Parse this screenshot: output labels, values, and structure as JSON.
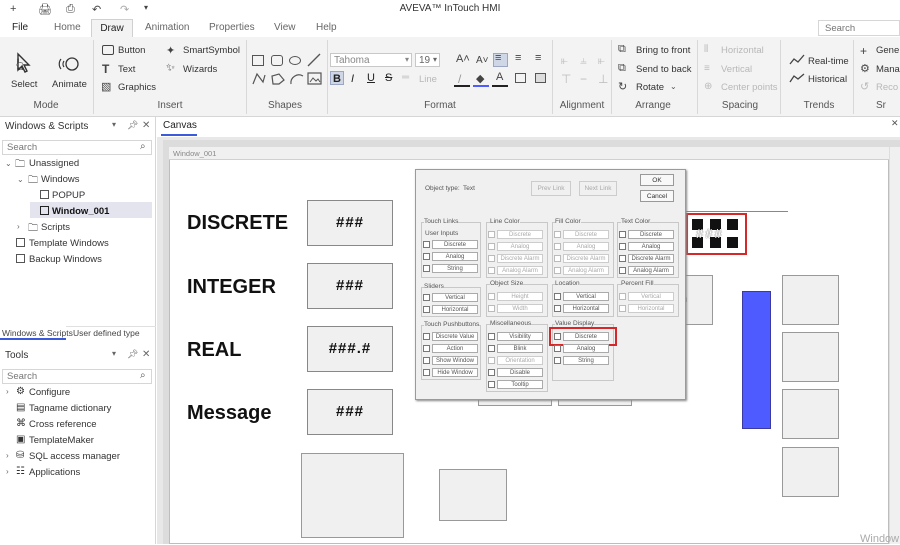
{
  "app": {
    "title": "AVEVA™ InTouch HMI"
  },
  "quick_access": {
    "new_icon": "+",
    "save_icon": "🖨",
    "print_icon": "⎙",
    "undo_icon": "↶",
    "redo_icon": "↷",
    "more_icon": "▾"
  },
  "menu": {
    "items": [
      "File",
      "Home",
      "Draw",
      "Animation",
      "Properties",
      "View",
      "Help"
    ],
    "active": "Draw"
  },
  "search": {
    "placeholder": "Search"
  },
  "ribbon": {
    "mode": {
      "select": "Select",
      "animate": "Animate",
      "group": "Mode"
    },
    "insert": {
      "button": "Button",
      "text": "Text",
      "graphics": "Graphics",
      "smartsymbol": "SmartSymbol",
      "wizards": "Wizards",
      "group": "Insert"
    },
    "shapes": {
      "group": "Shapes"
    },
    "format": {
      "font": "Tahoma",
      "size": "19",
      "line": "Line",
      "group": "Format"
    },
    "alignment": {
      "group": "Alignment"
    },
    "arrange": {
      "bring_front": "Bring to front",
      "send_back": "Send to back",
      "rotate": "Rotate",
      "group": "Arrange"
    },
    "spacing": {
      "horizontal": "Horizontal",
      "vertical": "Vertical",
      "center_points": "Center points",
      "group": "Spacing"
    },
    "trends": {
      "realtime": "Real-time",
      "historical": "Historical",
      "group": "Trends"
    },
    "smart": {
      "generate": "Gene",
      "manage": "Mana",
      "recover": "Reco",
      "group": "Sr"
    }
  },
  "windows_panel": {
    "title": "Windows & Scripts",
    "search_placeholder": "Search",
    "tree": {
      "unassigned": "Unassigned",
      "windows": "Windows",
      "popup": "POPUP",
      "window_001": "Window_001",
      "scripts": "Scripts",
      "template_windows": "Template Windows",
      "backup_windows": "Backup Windows"
    },
    "tabs": [
      "Windows & Scripts",
      "User defined type"
    ]
  },
  "tools_panel": {
    "title": "Tools",
    "search_placeholder": "Search",
    "items": [
      "Configure",
      "Tagname dictionary",
      "Cross reference",
      "TemplateMaker",
      "SQL access manager",
      "Applications"
    ]
  },
  "canvas": {
    "tab": "Canvas",
    "window_title": "Window_001",
    "labels": {
      "discrete": "DISCRETE",
      "integer": "INTEGER",
      "real": "REAL",
      "message": "Message"
    },
    "values": {
      "discrete": "###",
      "integer": "###",
      "real": "###.#",
      "message": "###"
    },
    "partial_text": "n",
    "corner_text": "Window"
  },
  "dialog": {
    "object_type_label": "Object type:",
    "object_type_value": "Text",
    "prev_link": "Prev Link",
    "next_link": "Next Link",
    "ok": "OK",
    "cancel": "Cancel",
    "touch_links": {
      "title": "Touch Links",
      "user_inputs": "User Inputs",
      "items": [
        "Discrete",
        "Analog",
        "String"
      ]
    },
    "line_color": {
      "title": "Line Color",
      "items": [
        "Discrete",
        "Analog",
        "Discrete Alarm",
        "Analog Alarm"
      ]
    },
    "fill_color": {
      "title": "Fill Color",
      "items": [
        "Discrete",
        "Analog",
        "Discrete Alarm",
        "Analog Alarm"
      ]
    },
    "text_color": {
      "title": "Text Color",
      "items": [
        "Discrete",
        "Analog",
        "Discrete Alarm",
        "Analog Alarm"
      ]
    },
    "sliders": {
      "title": "Sliders",
      "items": [
        "Vertical",
        "Horizontal"
      ]
    },
    "object_size": {
      "title": "Object Size",
      "items": [
        "Height",
        "Width"
      ]
    },
    "location": {
      "title": "Location",
      "items": [
        "Vertical",
        "Horizontal"
      ]
    },
    "percent_fill": {
      "title": "Percent Fill",
      "items": [
        "Vertical",
        "Horizontal"
      ]
    },
    "touch_pushbuttons": {
      "title": "Touch Pushbuttons",
      "items": [
        "Discrete Value",
        "Action",
        "Show Window",
        "Hide Window"
      ]
    },
    "miscellaneous": {
      "title": "Miscellaneous",
      "items": [
        "Visibility",
        "Blink",
        "Orientation",
        "Disable",
        "Tooltip"
      ]
    },
    "value_display": {
      "title": "Value Display",
      "items": [
        "Discrete",
        "Analog",
        "String"
      ]
    }
  },
  "colors": {
    "accent": "#3b5bdb",
    "highlight": "#d62828",
    "bar": "#4d5bff"
  }
}
